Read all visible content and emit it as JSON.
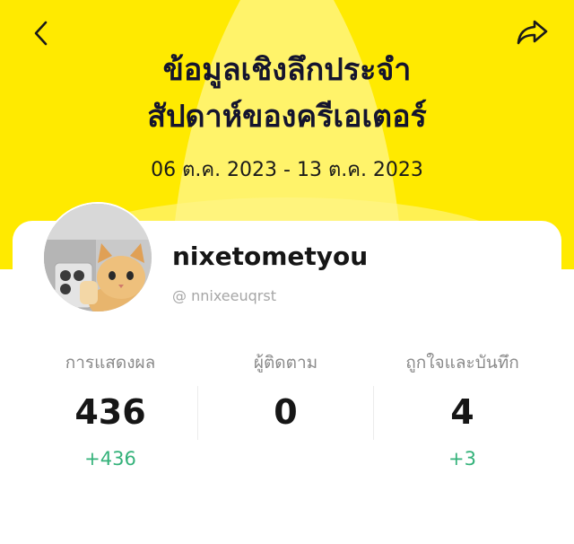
{
  "nav": {
    "back_icon": "back-chevron-icon",
    "share_icon": "share-arrow-icon"
  },
  "header": {
    "title_line1": "ข้อมูลเชิงลึกประจำ",
    "title_line2": "สัปดาห์ของครีเอเตอร์",
    "date_range": "06 ต.ค. 2023 - 13 ต.ค. 2023"
  },
  "profile": {
    "username": "nixetometyou",
    "handle": "@ nnixeeuqrst",
    "avatar_icon": "cat-selfie-avatar"
  },
  "stats": [
    {
      "label": "การแสดงผล",
      "value": "436",
      "change": "+436"
    },
    {
      "label": "ผู้ติดตาม",
      "value": "0",
      "change": ""
    },
    {
      "label": "ถูกใจและบันทึก",
      "value": "4",
      "change": "+3"
    }
  ],
  "colors": {
    "header_yellow": "#fff36a",
    "beam_yellow": "#ffeb00",
    "title": "#14142e",
    "positive_change": "#34b27a",
    "muted_text": "#8a8a8a"
  }
}
